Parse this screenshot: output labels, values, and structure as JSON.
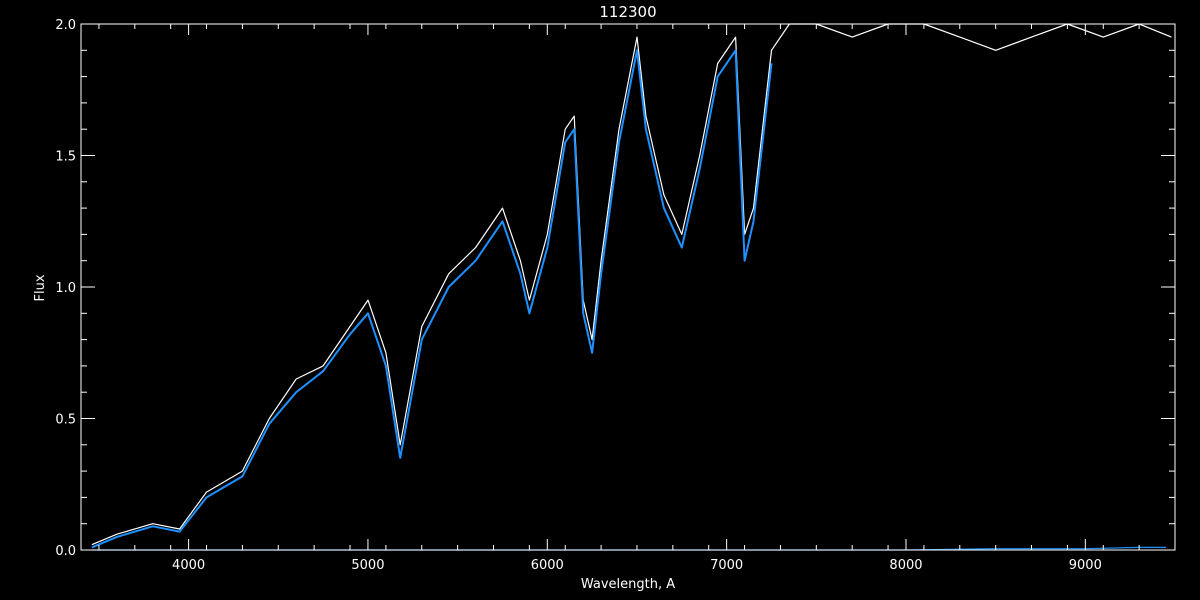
{
  "chart_data": {
    "type": "line",
    "title": "112300",
    "xlabel": "Wavelength, A",
    "ylabel": "Flux",
    "xlim": [
      3400,
      9500
    ],
    "ylim": [
      0.0,
      2.0
    ],
    "xticks": [
      4000,
      5000,
      6000,
      7000,
      8000,
      9000
    ],
    "xtick_labels": [
      "4000",
      "5000",
      "6000",
      "7000",
      "8000",
      "9000"
    ],
    "yticks": [
      0.0,
      0.5,
      1.0,
      1.5,
      2.0
    ],
    "ytick_labels": [
      "0.0",
      "0.5",
      "1.0",
      "1.5",
      "2.0"
    ],
    "grid": false,
    "background": "#000000",
    "axis_color": "#ffffff",
    "series": [
      {
        "color": "#ffffff",
        "x": [
          3460,
          3600,
          3800,
          3950,
          4100,
          4300,
          4450,
          4600,
          4750,
          4900,
          5000,
          5100,
          5180,
          5300,
          5450,
          5600,
          5750,
          5850,
          5900,
          6000,
          6100,
          6150,
          6200,
          6250,
          6300,
          6400,
          6500,
          6550,
          6650,
          6750,
          6850,
          6950,
          7050,
          7100,
          7150,
          7250,
          7350,
          7500,
          7700,
          7900,
          8100,
          8300,
          8500,
          8700,
          8900,
          9100,
          9300,
          9480
        ],
        "y": [
          0.02,
          0.06,
          0.1,
          0.08,
          0.22,
          0.3,
          0.5,
          0.65,
          0.7,
          0.85,
          0.95,
          0.75,
          0.4,
          0.85,
          1.05,
          1.15,
          1.3,
          1.1,
          0.95,
          1.2,
          1.6,
          1.65,
          0.95,
          0.8,
          1.1,
          1.6,
          1.95,
          1.65,
          1.35,
          1.2,
          1.5,
          1.85,
          1.95,
          1.2,
          1.3,
          1.9,
          2.0,
          2.0,
          1.95,
          2.0,
          2.0,
          1.95,
          1.9,
          1.95,
          2.0,
          1.95,
          2.0,
          1.95
        ]
      },
      {
        "color": "#1e90ff",
        "x": [
          3460,
          3600,
          3800,
          3950,
          4100,
          4300,
          4450,
          4600,
          4750,
          4900,
          5000,
          5100,
          5180,
          5300,
          5450,
          5600,
          5750,
          5850,
          5900,
          6000,
          6100,
          6150,
          6200,
          6250,
          6300,
          6400,
          6500,
          6550,
          6650,
          6750,
          6850,
          6950,
          7050,
          7100,
          7150,
          7250
        ],
        "y": [
          0.01,
          0.05,
          0.09,
          0.07,
          0.2,
          0.28,
          0.48,
          0.6,
          0.68,
          0.82,
          0.9,
          0.7,
          0.35,
          0.8,
          1.0,
          1.1,
          1.25,
          1.05,
          0.9,
          1.15,
          1.55,
          1.6,
          0.9,
          0.75,
          1.05,
          1.55,
          1.9,
          1.6,
          1.3,
          1.15,
          1.45,
          1.8,
          1.9,
          1.1,
          1.25,
          1.85
        ]
      },
      {
        "color": "#1e90ff",
        "x": [
          3460,
          4000,
          5000,
          6000,
          7000,
          8000,
          8500,
          9000,
          9300,
          9450
        ],
        "y": [
          0.0,
          0.0,
          0.0,
          0.0,
          0.0,
          0.0,
          0.005,
          0.005,
          0.01,
          0.01
        ]
      }
    ]
  }
}
